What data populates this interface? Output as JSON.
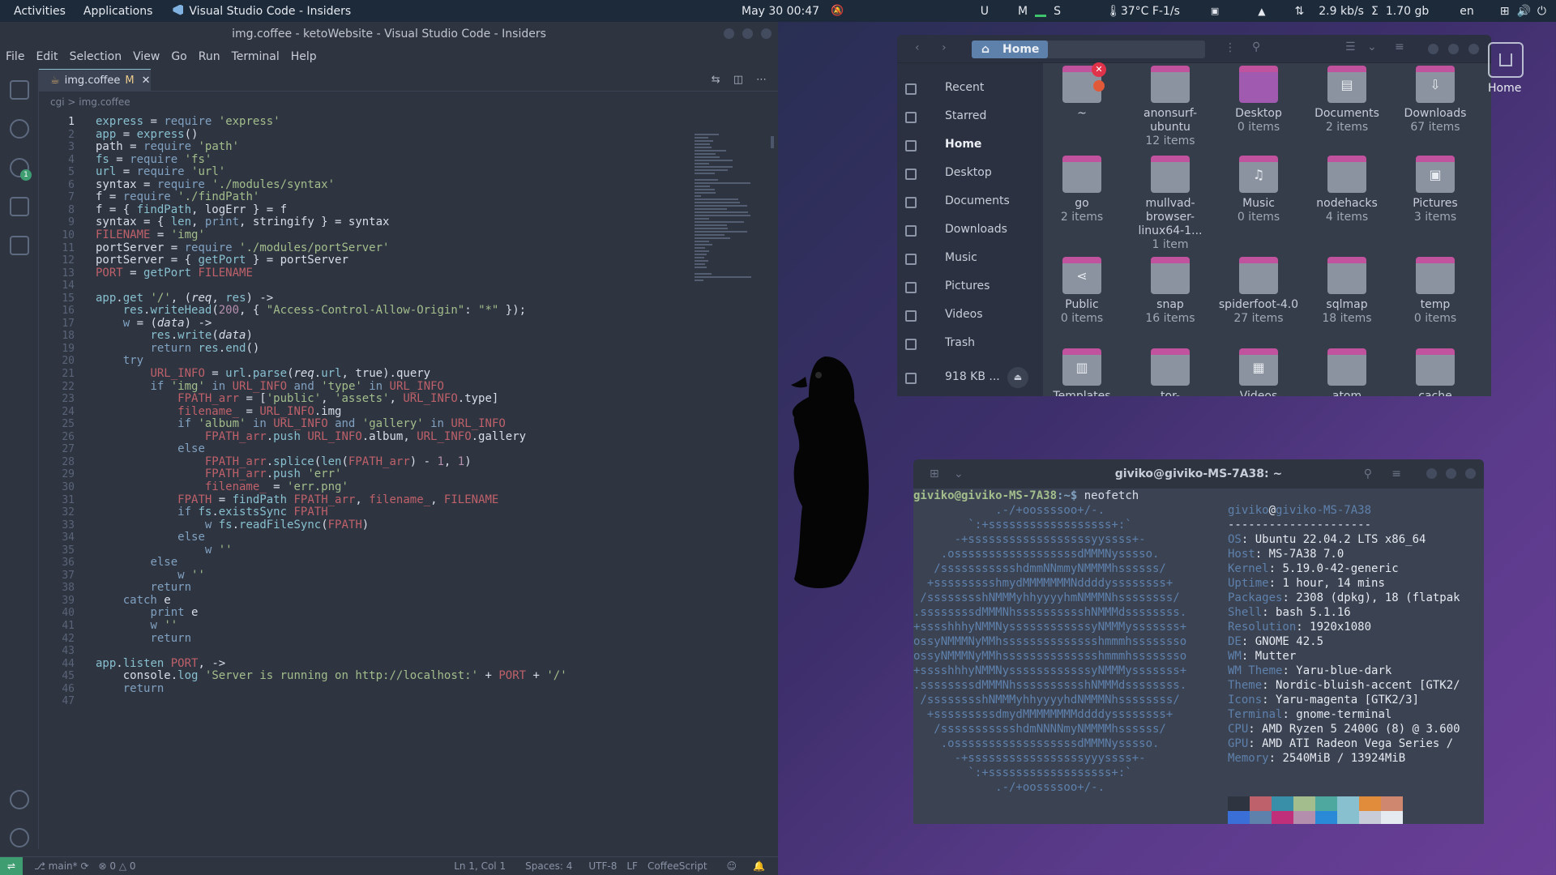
{
  "topbar": {
    "activities": "Activities",
    "applications": "Applications",
    "active_app": "Visual Studio Code - Insiders",
    "date": "May 30",
    "time": "00:47",
    "indicators": [
      "U",
      "M",
      "S"
    ],
    "temp": "37°C F-1/s",
    "net": "2.9 kb/s",
    "sigma": "1.70 gb",
    "lang": "en"
  },
  "vscode": {
    "title": "img.coffee - ketoWebsite - Visual Studio Code - Insiders",
    "menu": [
      "File",
      "Edit",
      "Selection",
      "View",
      "Go",
      "Run",
      "Terminal",
      "Help"
    ],
    "tab_label": "img.coffee",
    "tab_modified": "M",
    "breadcrumb": "cgi  >  img.coffee",
    "status": {
      "branch": "main*",
      "problems": "0 △ 0",
      "position": "Ln 1, Col 1",
      "spaces": "Spaces: 4",
      "encoding": "UTF-8",
      "eol": "LF",
      "language": "CoffeeScript"
    },
    "scm_badge": "1"
  },
  "code_lines": [
    "express = require 'express'",
    "app = express()",
    "path = require 'path'",
    "fs = require 'fs'",
    "url = require 'url'",
    "syntax = require './modules/syntax'",
    "f = require './findPath'",
    "f = { findPath, logErr } = f",
    "syntax = { len, print, stringify } = syntax",
    "FILENAME = 'img'",
    "portServer = require './modules/portServer'",
    "portServer = { getPort } = portServer",
    "PORT = getPort FILENAME",
    "",
    "app.get '/', (req, res) ->",
    "    res.writeHead(200, { \"Access-Control-Allow-Origin\": \"*\" });",
    "    w = (data) ->",
    "        res.write(data)",
    "        return res.end()",
    "    try",
    "        URL_INFO = url.parse(req.url, true).query",
    "        if 'img' in URL_INFO and 'type' in URL_INFO",
    "            FPATH_arr = ['public', 'assets', URL_INFO.type]",
    "            filename_ = URL_INFO.img",
    "            if 'album' in URL_INFO and 'gallery' in URL_INFO",
    "                FPATH_arr.push URL_INFO.album, URL_INFO.gallery",
    "            else",
    "                FPATH_arr.splice(len(FPATH_arr) - 1, 1)",
    "                FPATH_arr.push 'err'",
    "                filename_ = 'err.png'",
    "            FPATH = findPath FPATH_arr, filename_, FILENAME",
    "            if fs.existsSync FPATH",
    "                w fs.readFileSync(FPATH)",
    "            else",
    "                w ''",
    "        else",
    "            w ''",
    "        return",
    "    catch e",
    "        print e",
    "        w ''",
    "        return",
    "",
    "app.listen PORT, ->",
    "    console.log 'Server is running on http://localhost:' + PORT + '/'",
    "    return",
    ""
  ],
  "files": {
    "location": "Home",
    "sidebar": [
      "Recent",
      "Starred",
      "Home",
      "Desktop",
      "Documents",
      "Downloads",
      "Music",
      "Pictures",
      "Videos",
      "Trash"
    ],
    "disk": "918 KB ...",
    "items": [
      {
        "name": "~",
        "sub": ""
      },
      {
        "name": "anonsurf-ubuntu",
        "sub": "12 items"
      },
      {
        "name": "Desktop",
        "sub": "0 items"
      },
      {
        "name": "Documents",
        "sub": "2 items"
      },
      {
        "name": "Downloads",
        "sub": "67 items"
      },
      {
        "name": "go",
        "sub": "2 items"
      },
      {
        "name": "mullvad-browser-linux64-1...",
        "sub": "1 item"
      },
      {
        "name": "Music",
        "sub": "0 items"
      },
      {
        "name": "nodehacks",
        "sub": "4 items"
      },
      {
        "name": "Pictures",
        "sub": "3 items"
      },
      {
        "name": "Public",
        "sub": "0 items"
      },
      {
        "name": "snap",
        "sub": "16 items"
      },
      {
        "name": "spiderfoot-4.0",
        "sub": "27 items"
      },
      {
        "name": "sqlmap",
        "sub": "18 items"
      },
      {
        "name": "temp",
        "sub": "0 items"
      },
      {
        "name": "Templates",
        "sub": ""
      },
      {
        "name": "tor-",
        "sub": ""
      },
      {
        "name": "Videos",
        "sub": ""
      },
      {
        "name": "atom",
        "sub": ""
      },
      {
        "name": "cache",
        "sub": ""
      }
    ]
  },
  "desktop": {
    "home_label": "Home"
  },
  "terminal": {
    "title": "giviko@giviko-MS-7A38: ~",
    "prompt": "giviko@giviko-MS-7A38",
    "prompt_path": ":~$",
    "command": "neofetch",
    "user": "giviko",
    "host": "giviko-MS-7A38",
    "separator": "---------------------",
    "info": [
      {
        "label": "OS",
        "value": "Ubuntu 22.04.2 LTS x86_64"
      },
      {
        "label": "Host",
        "value": "MS-7A38 7.0"
      },
      {
        "label": "Kernel",
        "value": "5.19.0-42-generic"
      },
      {
        "label": "Uptime",
        "value": "1 hour, 14 mins"
      },
      {
        "label": "Packages",
        "value": "2308 (dpkg), 18 (flatpak"
      },
      {
        "label": "Shell",
        "value": "bash 5.1.16"
      },
      {
        "label": "Resolution",
        "value": "1920x1080"
      },
      {
        "label": "DE",
        "value": "GNOME 42.5"
      },
      {
        "label": "WM",
        "value": "Mutter"
      },
      {
        "label": "WM Theme",
        "value": "Yaru-blue-dark"
      },
      {
        "label": "Theme",
        "value": "Nordic-bluish-accent [GTK2/"
      },
      {
        "label": "Icons",
        "value": "Yaru-magenta [GTK2/3]"
      },
      {
        "label": "Terminal",
        "value": "gnome-terminal"
      },
      {
        "label": "CPU",
        "value": "AMD Ryzen 5 2400G (8) @ 3.600"
      },
      {
        "label": "GPU",
        "value": "AMD ATI Radeon Vega Series /"
      },
      {
        "label": "Memory",
        "value": "2540MiB / 13924MiB"
      }
    ],
    "ascii": [
      "            .-/+oossssoo+/-.",
      "        `:+ssssssssssssssssss+:`",
      "      -+ssssssssssssssssssyyssss+-",
      "    .ossssssssssssssssssdMMMNysssso.",
      "   /ssssssssssshdmmNNmmyNMMMMhssssss/",
      "  +ssssssssshmydMMMMMMMNddddyssssssss+",
      " /sssssssshNMMMyhhyyyyhmNMMMNhssssssss/",
      ".ssssssssdMMMNhsssssssssshNMMMdssssssss.",
      "+sssshhhyNMMNyssssssssssssyNMMMysssssss+",
      "ossyNMMMNyMMhsssssssssssssshmmmhssssssso",
      "ossyNMMMNyMMhsssssssssssssshmmmhssssssso",
      "+sssshhhyNMMNyssssssssssssyNMMMysssssss+",
      ".ssssssssdMMMNhsssssssssshNMMMdssssssss.",
      " /sssssssshNMMMyhhyyyyhdNMMMNhssssssss/",
      "  +sssssssssdmydMMMMMMMMddddyssssssss+",
      "   /ssssssssssshdmNNNNmyNMMMMhssssss/",
      "    .ossssssssssssssssssdMMMNysssso.",
      "      -+sssssssssssssssssyyyssss+-",
      "        `:+ssssssssssssssssss+:`",
      "            .-/+oossssoo+/-."
    ],
    "swatches": [
      "#2e3440",
      "#bf616a",
      "#3a8fa8",
      "#a3be8c",
      "#4fa8a0",
      "#88c0d0",
      "#e08c3a",
      "#d08770",
      "#3a6fd8",
      "#5e81ac",
      "#c0307a",
      "#b48ead",
      "#2a8ad8",
      "#88c0d0",
      "#c8ccd8",
      "#e5e9f0"
    ]
  }
}
